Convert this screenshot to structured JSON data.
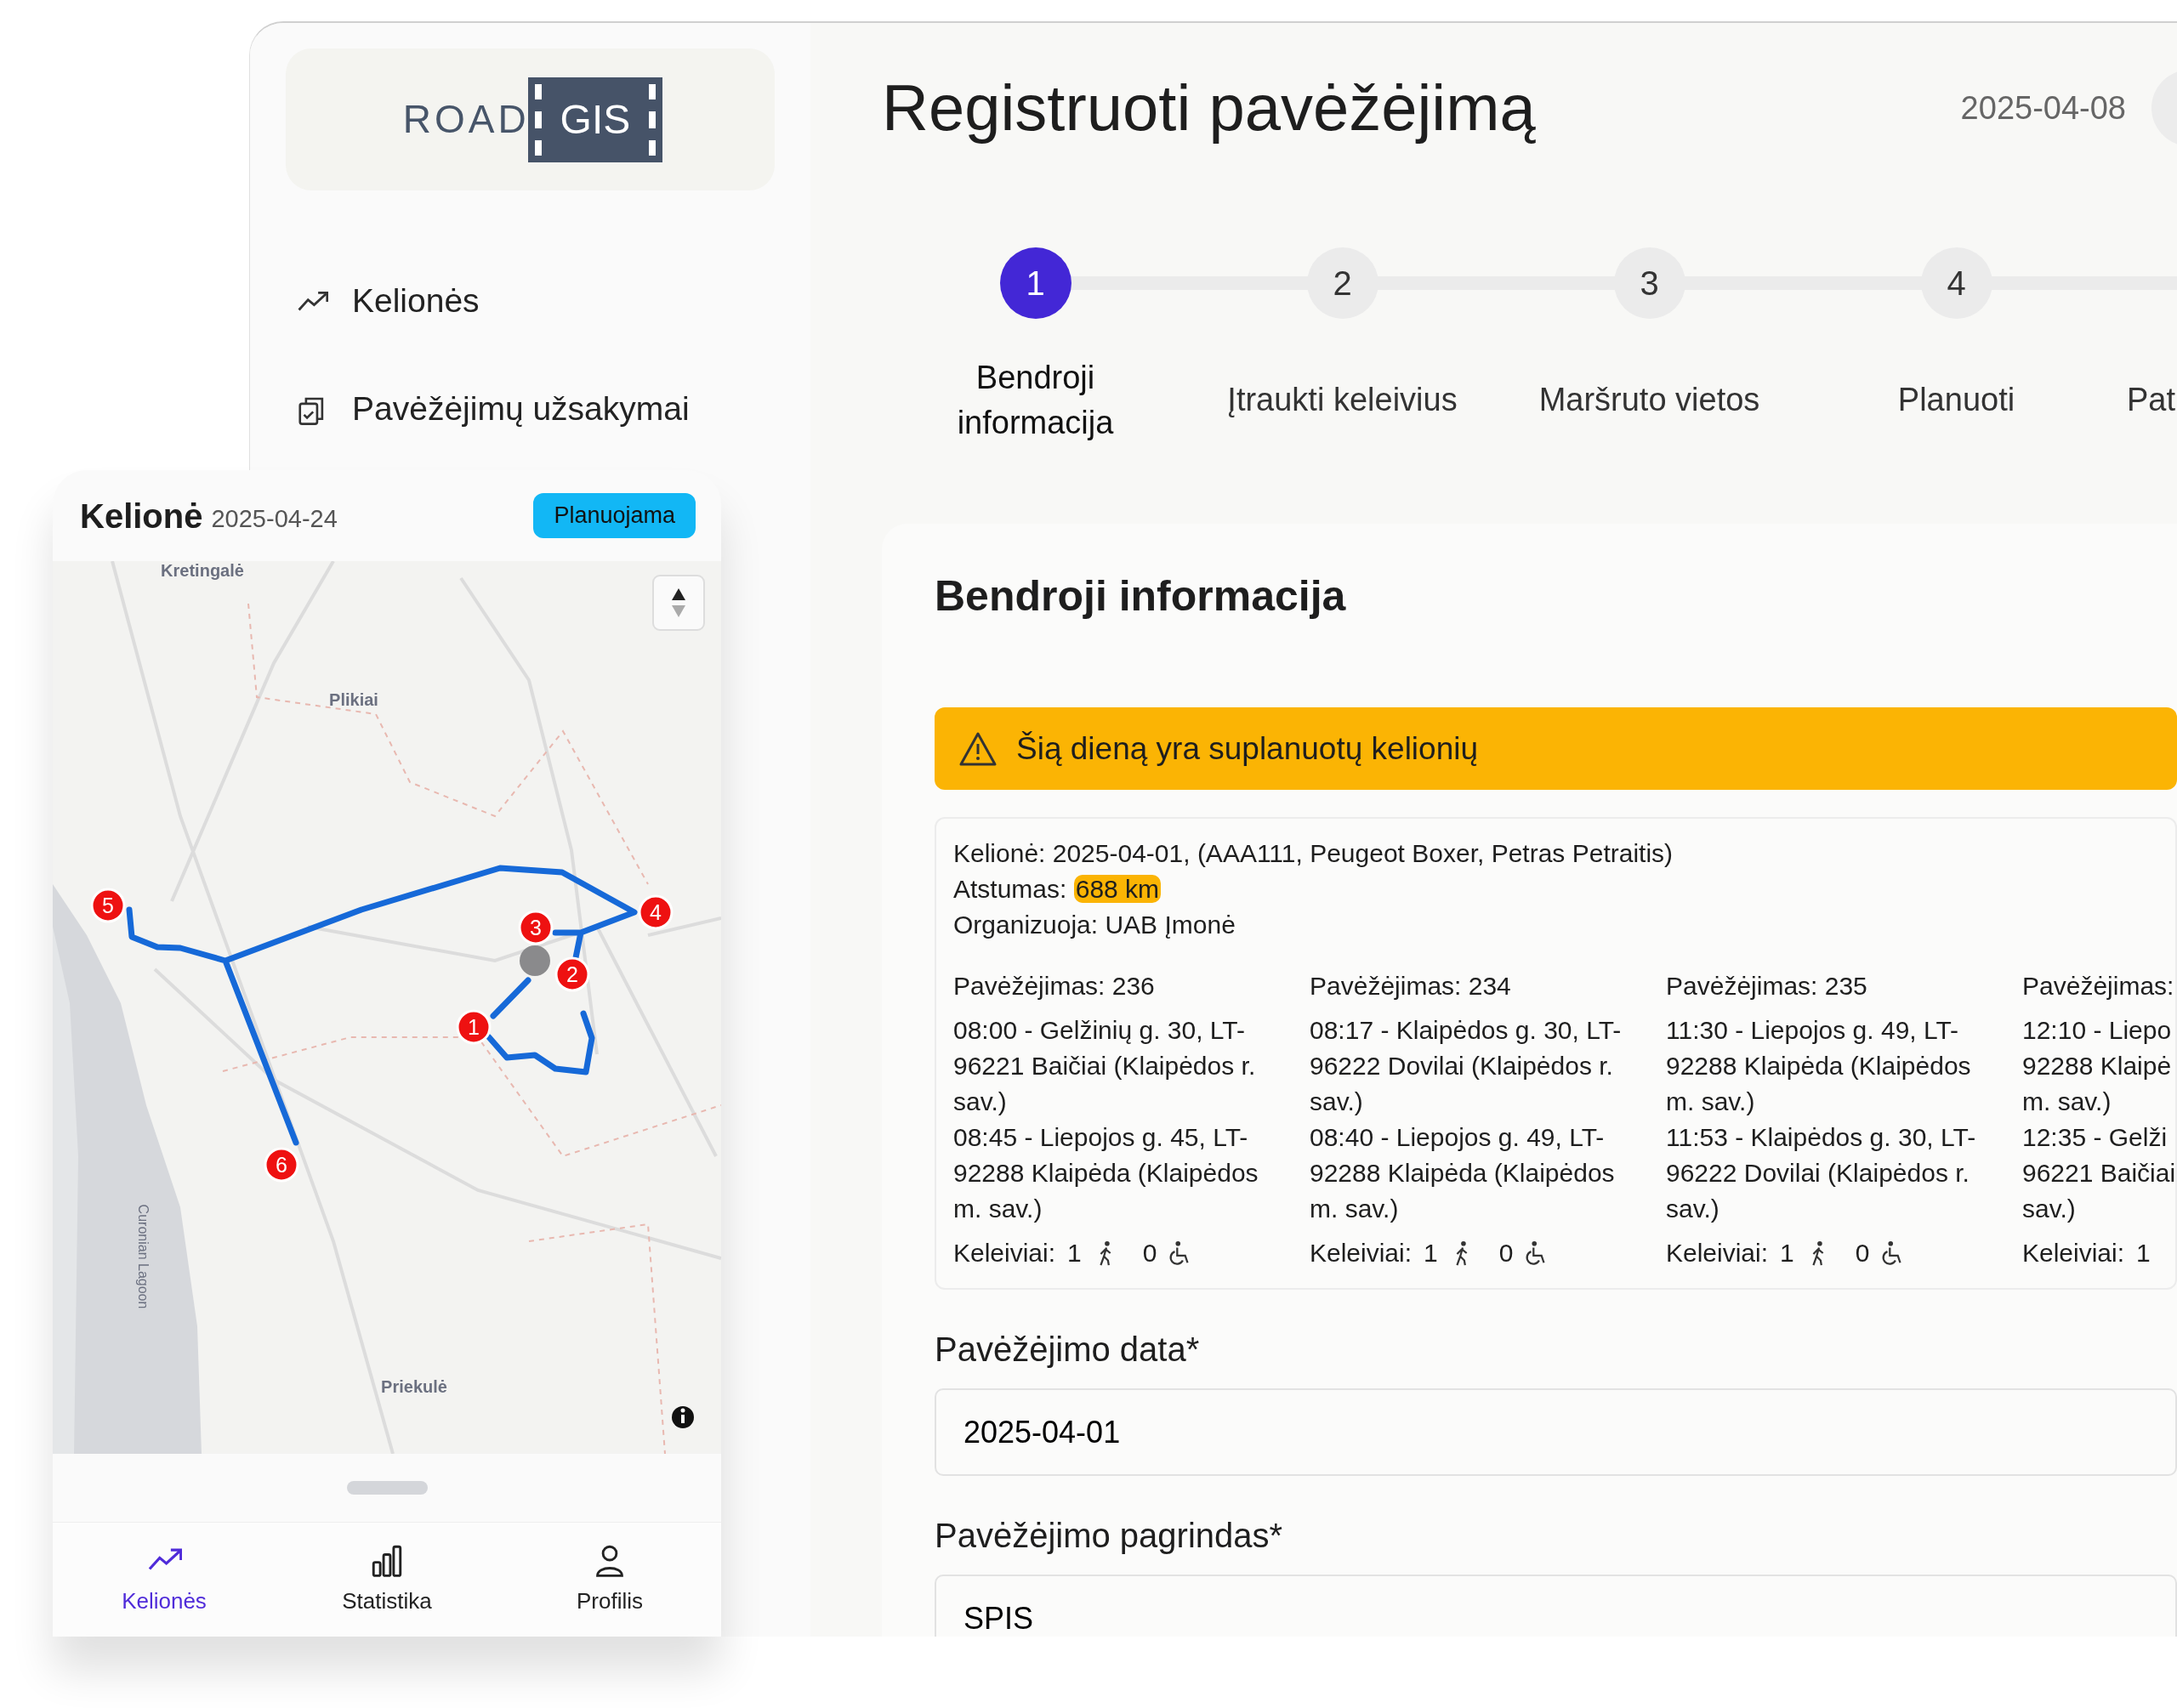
{
  "logo": {
    "left": "ROAD",
    "right": "GIS"
  },
  "sidebar": {
    "items": [
      {
        "label": "Kelionės",
        "kind": "trend"
      },
      {
        "label": "Pavėžėjimų užsakymai",
        "kind": "orders"
      }
    ]
  },
  "header": {
    "title": "Registruoti pavėžėjimą",
    "date": "2025-04-08"
  },
  "steps": [
    {
      "number": "1",
      "label": "Bendroji informacija",
      "selected": true
    },
    {
      "number": "2",
      "label": "Įtraukti keleivius",
      "selected": false
    },
    {
      "number": "3",
      "label": "Maršruto vietos",
      "selected": false
    },
    {
      "number": "4",
      "label": "Planuoti",
      "selected": false
    },
    {
      "label": "Pat"
    }
  ],
  "section": {
    "title": "Bendroji informacija",
    "alert": "Šią dieną yra suplanuotų kelionių",
    "trip": {
      "line": "Kelionė: 2025-04-01, (AAA111, Peugeot Boxer, Petras Petraitis)",
      "distance_label": "Atstumas:",
      "distance_value": "688 km",
      "organizer": "Organizuoja: UAB Įmonė",
      "rides": [
        {
          "title": "Pavėžėjimas: 236",
          "stops": [
            [
              "08:00 - Gelžinių g. 30, LT-",
              "96221 Baičiai (Klaipėdos r.",
              "sav.)"
            ],
            [
              "08:45 - Liepojos g. 45, LT-",
              "92288 Klaipėda (Klaipėdos",
              "m. sav.)"
            ]
          ],
          "passengers": {
            "label": "Keleiviai:",
            "walking": "1",
            "wheelchair": "0"
          }
        },
        {
          "title": "Pavėžėjimas: 234",
          "stops": [
            [
              "08:17 - Klaipėdos g. 30, LT-",
              "96222 Dovilai (Klaipėdos r.",
              "sav.)"
            ],
            [
              "08:40 - Liepojos g. 49, LT-",
              "92288 Klaipėda (Klaipėdos",
              "m. sav.)"
            ]
          ],
          "passengers": {
            "label": "Keleiviai:",
            "walking": "1",
            "wheelchair": "0"
          }
        },
        {
          "title": "Pavėžėjimas: 235",
          "stops": [
            [
              "11:30 - Liepojos g. 49, LT-",
              "92288 Klaipėda (Klaipėdos",
              "m. sav.)"
            ],
            [
              "11:53 - Klaipėdos g. 30, LT-",
              "96222 Dovilai (Klaipėdos r.",
              "sav.)"
            ]
          ],
          "passengers": {
            "label": "Keleiviai:",
            "walking": "1",
            "wheelchair": "0"
          }
        },
        {
          "title": "Pavėžėjimas:",
          "stops": [
            [
              "12:10 - Liepo",
              "92288 Klaipė",
              "m. sav.)"
            ],
            [
              "12:35 - Gelži",
              "96221 Baičiai",
              "sav.)"
            ]
          ],
          "passengers": {
            "label": "Keleiviai:",
            "walking": "1"
          }
        }
      ]
    },
    "fields": [
      {
        "label": "Pavėžėjimo data*",
        "value": "2025-04-01"
      },
      {
        "label": "Pavėžėjimo pagrindas*",
        "value": "SPIS"
      }
    ]
  },
  "phone": {
    "title": "Kelionė",
    "date": "2025-04-24",
    "status": "Planuojama",
    "map": {
      "labels": [
        "Kretingalė",
        "Plikiai",
        "Priekulė",
        "Curonian Lagoon"
      ],
      "markers": [
        "1",
        "2",
        "3",
        "4",
        "5",
        "6"
      ]
    },
    "tabs": [
      {
        "label": "Kelionės",
        "kind": "trend",
        "selected": true
      },
      {
        "label": "Statistika",
        "kind": "chart",
        "selected": false
      },
      {
        "label": "Profilis",
        "kind": "person",
        "selected": false
      }
    ]
  }
}
